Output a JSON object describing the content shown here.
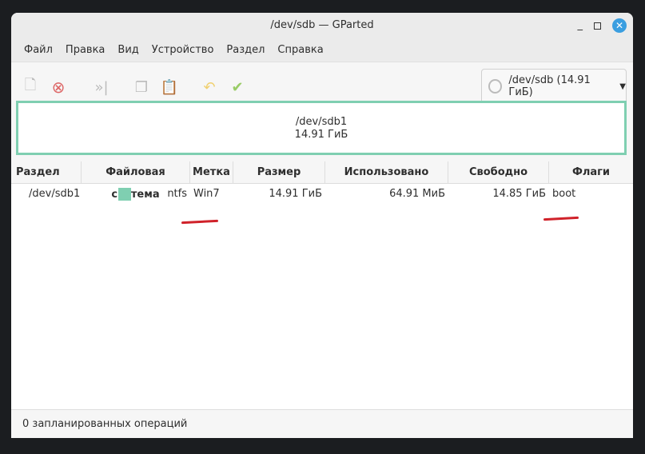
{
  "window": {
    "title": "/dev/sdb — GParted"
  },
  "menu": [
    "Файл",
    "Правка",
    "Вид",
    "Устройство",
    "Раздел",
    "Справка"
  ],
  "device_selector": {
    "value": "/dev/sdb (14.91 ГиБ)"
  },
  "map": {
    "name": "/dev/sdb1",
    "size": "14.91 ГиБ",
    "color": "#7fcfb1"
  },
  "table": {
    "headers": [
      "Раздел",
      "Файловая система",
      "Метка",
      "Размер",
      "Использовано",
      "Свободно",
      "Флаги"
    ],
    "rows": [
      {
        "partition": "/dev/sdb1",
        "fs": "ntfs",
        "label": "Win7",
        "size": "14.91 ГиБ",
        "used": "64.91 МиБ",
        "free": "14.85 ГиБ",
        "flags": "boot"
      }
    ]
  },
  "status": "0 запланированных операций"
}
